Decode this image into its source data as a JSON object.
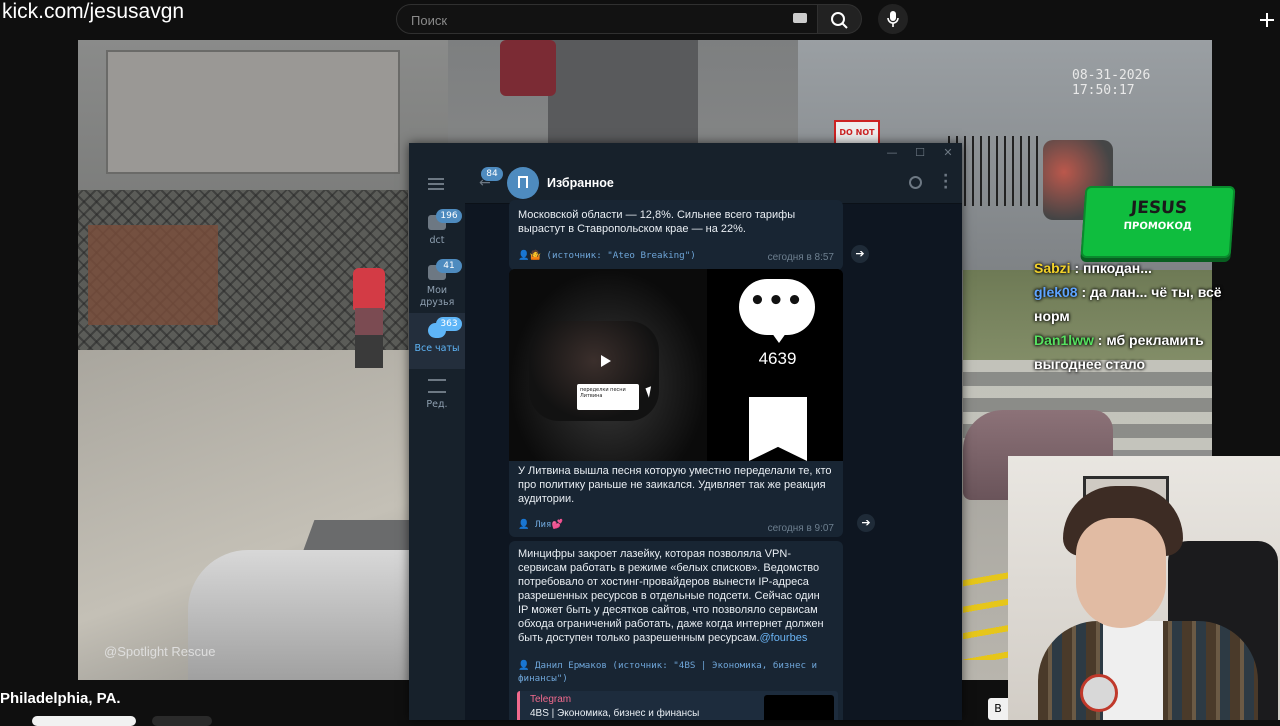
{
  "browser": {
    "site_url": "kick.com/jesusavgn",
    "search_placeholder": "Поиск"
  },
  "stream": {
    "timestamp": "08-31-2026 17:50:17",
    "watermark": "@Spotlight Rescue",
    "stop_sign": "DO NOT",
    "location": "Philadelphia, PA.",
    "promo_title": "JESUS",
    "promo_subtitle": "ПРОМОКОД",
    "bottom_button": "В"
  },
  "chat": [
    {
      "user": "Sabzi",
      "text": " : ппкодан..."
    },
    {
      "user": "glek08",
      "text": " : да лан... чё ты, всё норм"
    },
    {
      "user": "Dan1lww",
      "text": " : мб рекламить выгоднее стало"
    }
  ],
  "telegram": {
    "window_buttons": [
      "—",
      "☐",
      "✕"
    ],
    "back_badge": "84",
    "chat_title": "Избранное",
    "folders": [
      {
        "label": "dct",
        "badge": "196"
      },
      {
        "label": "Мои друзья",
        "badge": "41"
      },
      {
        "label": "Все чаты",
        "badge": "363"
      },
      {
        "label": "Ред.",
        "badge": ""
      }
    ],
    "messages": [
      {
        "text": "Московской области — 12,8%. Сильнее всего тарифы вырастут в Ставропольском крае — на 22%.",
        "source": "👤🤷 (источник: \"Ateo Breaking\")",
        "time": "сегодня в 8:57"
      },
      {
        "text": "У Литвина вышла песня которую уместно переделали те, кто про политику раньше не заикался. Удивляет так же реакция аудитории.",
        "source": "👤 Лия💕",
        "time": "сегодня в 9:07",
        "media_views": "4639",
        "video_card": "переделки песни Литвина"
      },
      {
        "text": "Минцифры закроет лазейку, которая позволяла VPN-сервисам работать в режиме «белых списков». Ведомство потребовало от хостинг-провайдеров вынести IP-адреса разрешенных ресурсов в отдельные подсети. Сейчас один IP может быть у десятков сайтов, что позволяло сервисам обхода ограничений работать, даже когда интернет должен быть доступен только разрешенным ресурсам.",
        "link": "@fourbes",
        "source": "👤 Данил Ермаков (источник: \"4BS | Экономика, бизнес и финансы\")",
        "preview_site": "Telegram",
        "preview_title": "4BS | Экономика, бизнес и финансы"
      }
    ]
  }
}
